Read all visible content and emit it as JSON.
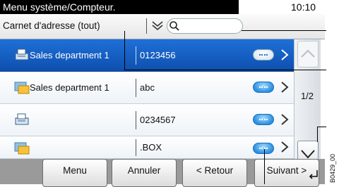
{
  "status": {
    "title": "Menu système/Compteur.",
    "time": "10:10"
  },
  "filter": {
    "label": "Carnet d'adresse (tout)",
    "search_placeholder": ""
  },
  "rows": [
    {
      "name": "Sales department 1",
      "value": "0123456",
      "icon": "fax-machine-icon",
      "selected": true
    },
    {
      "name": "Sales department 1",
      "value": "abc",
      "icon": "folder-icon",
      "selected": false
    },
    {
      "name": "",
      "value": "0234567",
      "icon": "fax-machine-icon",
      "selected": false
    },
    {
      "name": "",
      "value": ".BOX",
      "icon": "folder-icon",
      "selected": false
    }
  ],
  "pager": {
    "page": "1/2"
  },
  "buttons": {
    "menu": "Menu",
    "cancel": "Annuler",
    "back": "< Retour",
    "next": "Suivant >"
  },
  "figure_code": "B0429_00",
  "colors": {
    "selected_row": "#1560c8",
    "status_bar": "#000000",
    "detail_button": "#2b8fe0"
  }
}
